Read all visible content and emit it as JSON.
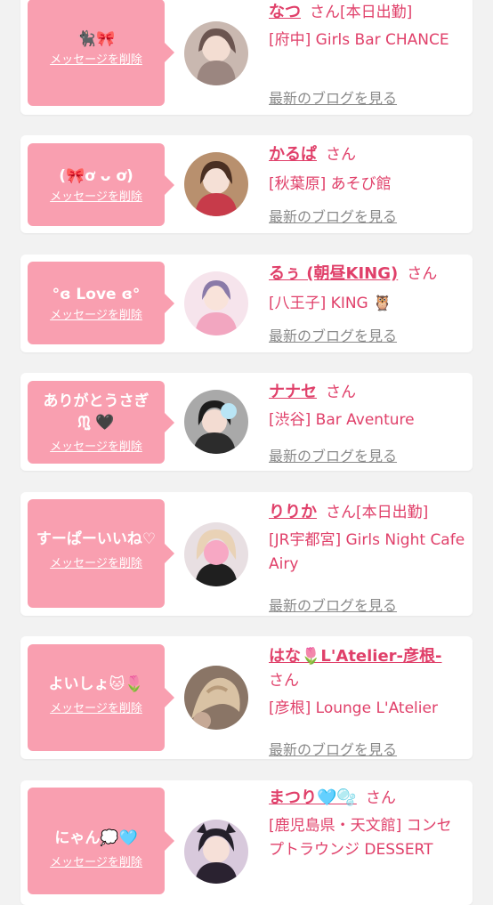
{
  "colors": {
    "accent": "#e0406a",
    "bubble": "#f99fb0",
    "card": "#ffffff",
    "page": "#f2f2f2",
    "link": "#8a8a8a"
  },
  "items": [
    {
      "message": "🐈‍⬛🎀",
      "delete_label": "メッセージを削除",
      "name": "なつ",
      "honorific": "さん",
      "status": "[本日出勤]",
      "shop": "[府中] Girls Bar CHANCE",
      "blog_label": "最新のブログを見る"
    },
    {
      "message": "(🎀ơ ᴗ ơ)",
      "delete_label": "メッセージを削除",
      "name": "かるぱ",
      "honorific": "さん",
      "status": "",
      "shop": "[秋葉原] あそび館",
      "blog_label": "最新のブログを見る"
    },
    {
      "message": "°ɞ Love ɞ°",
      "delete_label": "メッセージを削除",
      "name": "るぅ (朝昼KING)",
      "honorific": "さん",
      "status": "",
      "shop": "[八王子] KING 🦉",
      "blog_label": "最新のブログを見る"
    },
    {
      "message": "ありがとうさぎ ᙏ̤̫ 🖤",
      "delete_label": "メッセージを削除",
      "name": "ナナセ",
      "honorific": "さん",
      "status": "",
      "shop": "[渋谷] Bar Aventure",
      "blog_label": "最新のブログを見る"
    },
    {
      "message": "すーぱーいいね♡",
      "delete_label": "メッセージを削除",
      "name": "りりか",
      "honorific": "さん",
      "status": "[本日出勤]",
      "shop": "[JR宇都宮] Girls Night Cafe Airy",
      "blog_label": "最新のブログを見る"
    },
    {
      "message": "よいしょ🐱🌷",
      "delete_label": "メッセージを削除",
      "name": "はな🌷L'Atelier-彦根-",
      "honorific": "さん",
      "status": "",
      "shop": "[彦根] Lounge L'Atelier",
      "blog_label": "最新のブログを見る"
    },
    {
      "message": "にゃん💭🩵",
      "delete_label": "メッセージを削除",
      "name": "まつり🩵🫧",
      "honorific": "さん",
      "status": "",
      "shop": "[鹿児島県・天文館] コンセプトラウンジ DESSERT",
      "blog_label": ""
    }
  ]
}
